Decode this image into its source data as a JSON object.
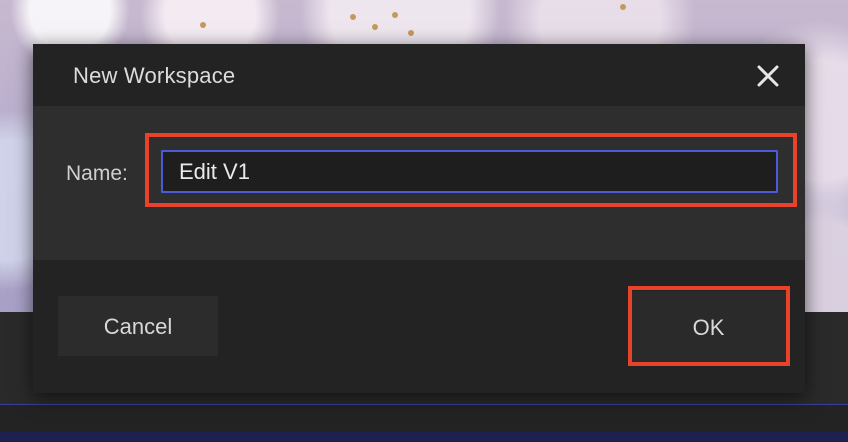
{
  "dialog": {
    "title": "New Workspace",
    "close_icon": "close-icon",
    "name_label": "Name:",
    "name_value": "Edit V1",
    "cancel_label": "Cancel",
    "ok_label": "OK"
  },
  "colors": {
    "dialog_bg": "#232323",
    "body_bg": "#2e2e2e",
    "input_border": "#4a5ad8",
    "highlight": "#e8432a",
    "text": "#dcdcdc"
  }
}
